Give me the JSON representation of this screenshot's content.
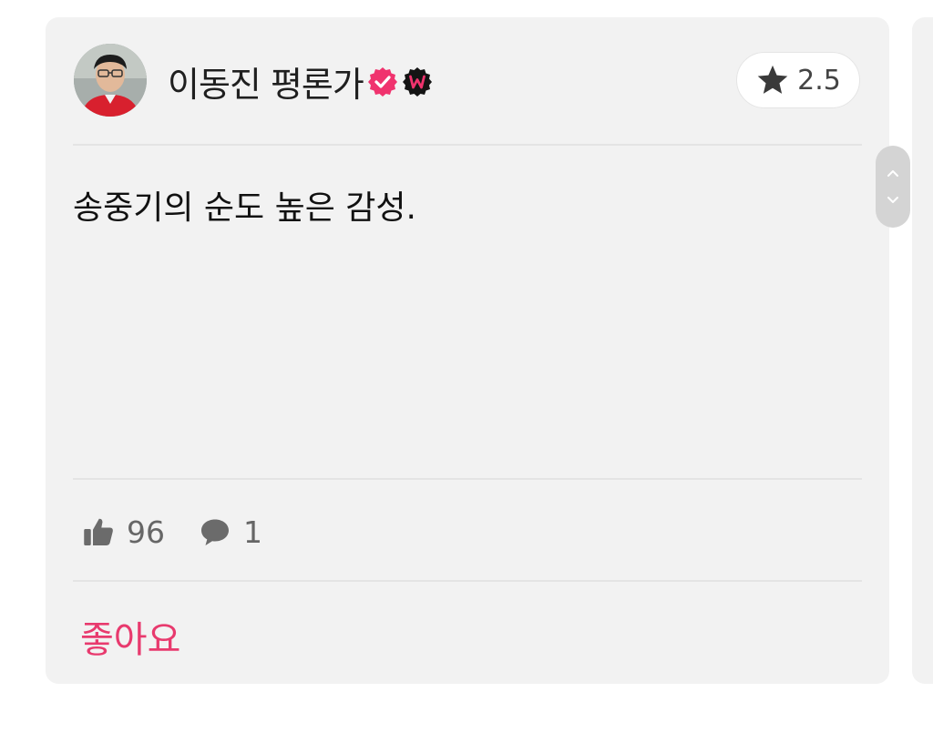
{
  "review": {
    "author": {
      "name": "이동진 평론가",
      "verified_badge_icon": "verified-check-icon",
      "watcha_badge_icon": "watcha-w-icon",
      "avatar_icon": "avatar"
    },
    "rating": {
      "icon": "star-icon",
      "value": "2.5"
    },
    "comment": "송중기의 순도 높은 감성.",
    "stats": {
      "likes_icon": "thumbs-up-icon",
      "likes": "96",
      "comments_icon": "comment-bubble-icon",
      "comments": "1"
    },
    "like_button_label": "좋아요"
  },
  "colors": {
    "card_bg": "#f2f2f2",
    "accent": "#e83a6e",
    "badge_pink": "#f0336e",
    "text_primary": "#111111",
    "text_secondary": "#666666"
  }
}
